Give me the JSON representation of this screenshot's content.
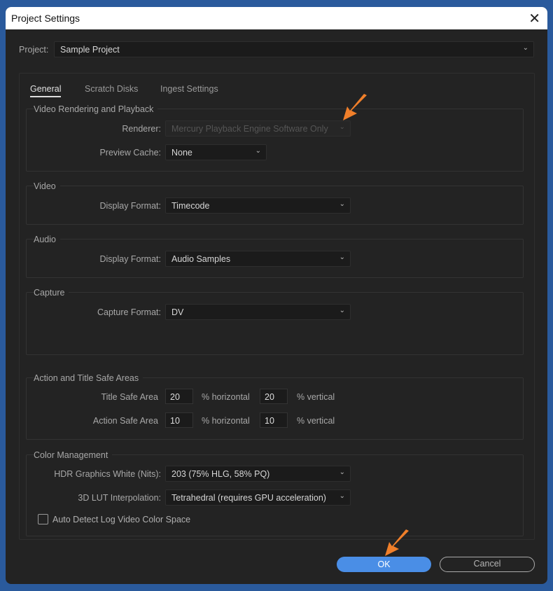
{
  "title": "Project Settings",
  "project": {
    "label": "Project:",
    "value": "Sample Project"
  },
  "tabs": [
    "General",
    "Scratch Disks",
    "Ingest Settings"
  ],
  "groups": {
    "vrp": {
      "title": "Video Rendering and Playback",
      "renderer_label": "Renderer:",
      "renderer_value": "Mercury Playback Engine Software Only",
      "cache_label": "Preview Cache:",
      "cache_value": "None"
    },
    "video": {
      "title": "Video",
      "label": "Display Format:",
      "value": "Timecode"
    },
    "audio": {
      "title": "Audio",
      "label": "Display Format:",
      "value": "Audio Samples"
    },
    "capture": {
      "title": "Capture",
      "label": "Capture Format:",
      "value": "DV"
    },
    "safe": {
      "title": "Action and Title Safe Areas",
      "title_safe_label": "Title Safe Area",
      "title_h": "20",
      "title_v": "20",
      "action_safe_label": "Action Safe Area",
      "action_h": "10",
      "action_v": "10",
      "horizontal": "% horizontal",
      "vertical": "% vertical"
    },
    "color": {
      "title": "Color Management",
      "hdr_label": "HDR Graphics White (Nits):",
      "hdr_value": "203 (75% HLG, 58% PQ)",
      "lut_label": "3D LUT Interpolation:",
      "lut_value": "Tetrahedral (requires GPU acceleration)",
      "auto_detect_label": "Auto Detect Log Video Color Space"
    }
  },
  "buttons": {
    "ok": "OK",
    "cancel": "Cancel"
  },
  "colors": {
    "accent": "#4a8ee6",
    "arrow": "#f07f2a"
  }
}
